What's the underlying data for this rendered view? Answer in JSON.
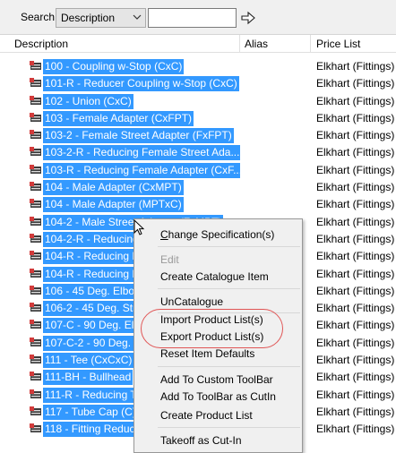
{
  "toolbar": {
    "search_label": "Search",
    "search_field": "Description",
    "search_value": ""
  },
  "columns": [
    "Description",
    "Alias",
    "Price List"
  ],
  "rows": [
    {
      "desc": "100 - Coupling w-Stop (CxC)",
      "price": "Elkhart (Fittings)"
    },
    {
      "desc": "101-R - Reducer Coupling w-Stop (CxC)",
      "price": "Elkhart (Fittings)"
    },
    {
      "desc": "102 - Union (CxC)",
      "price": "Elkhart (Fittings)"
    },
    {
      "desc": "103 - Female Adapter (CxFPT)",
      "price": "Elkhart (Fittings)"
    },
    {
      "desc": "103-2 - Female Street Adapter (FxFPT)",
      "price": "Elkhart (Fittings)"
    },
    {
      "desc": "103-2-R - Reducing Female Street Ada...",
      "price": "Elkhart (Fittings)"
    },
    {
      "desc": "103-R - Reducing Female Adapter (CxF...",
      "price": "Elkhart (Fittings)"
    },
    {
      "desc": "104 - Male Adapter (CxMPT)",
      "price": "Elkhart (Fittings)"
    },
    {
      "desc": "104 - Male Adapter (MPTxC)",
      "price": "Elkhart (Fittings)"
    },
    {
      "desc": "104-2 - Male Street Adapter (FxMPT)",
      "price": "Elkhart (Fittings)"
    },
    {
      "desc": "104-2-R - Reducing",
      "price": "Elkhart (Fittings)"
    },
    {
      "desc": "104-R - Reducing M",
      "price": "Elkhart (Fittings)"
    },
    {
      "desc": "104-R - Reducing M",
      "price": "Elkhart (Fittings)"
    },
    {
      "desc": "106 - 45 Deg. Elbow",
      "price": "Elkhart (Fittings)"
    },
    {
      "desc": "106-2 - 45 Deg. Stre",
      "price": "Elkhart (Fittings)"
    },
    {
      "desc": "107-C - 90 Deg. Elb",
      "price": "Elkhart (Fittings)"
    },
    {
      "desc": "107-C-2 - 90 Deg. St",
      "price": "Elkhart (Fittings)"
    },
    {
      "desc": "111 - Tee (CxCxC)",
      "price": "Elkhart (Fittings)"
    },
    {
      "desc": "111-BH - Bullhead",
      "price": "Elkhart (Fittings)"
    },
    {
      "desc": "111-R - Reducing T",
      "price": "Elkhart (Fittings)"
    },
    {
      "desc": "117 - Tube Cap (C)",
      "price": "Elkhart (Fittings)"
    },
    {
      "desc": "118 - Fitting Reduc",
      "price": "Elkhart (Fittings)"
    }
  ],
  "context_menu": [
    {
      "label": "Change Specification(s)",
      "enabled": true
    },
    {
      "label": "Edit",
      "enabled": false
    },
    {
      "label": "Create Catalogue Item",
      "enabled": true
    },
    {
      "label": "UnCatalogue",
      "enabled": true
    },
    {
      "label": "Import Product List(s)",
      "enabled": true
    },
    {
      "label": "Export Product List(s)",
      "enabled": true
    },
    {
      "label": "Reset Item Defaults",
      "enabled": true
    },
    {
      "label": "Add To Custom ToolBar",
      "enabled": true
    },
    {
      "label": "Add To ToolBar as CutIn",
      "enabled": true
    },
    {
      "label": "Create Product List",
      "enabled": true
    },
    {
      "label": "Takeoff as Cut-In",
      "enabled": true
    }
  ],
  "colors": {
    "selection": "#3399ff",
    "highlight_oval": "#e05555",
    "menu_bg": "#f0f0f0"
  }
}
